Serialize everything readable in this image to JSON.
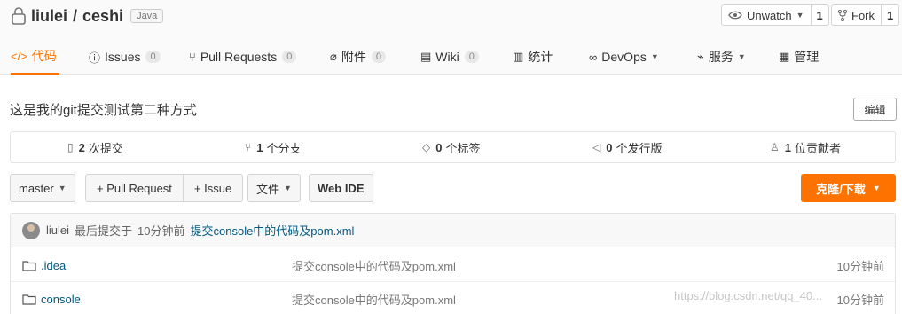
{
  "repo": {
    "owner": "liulei",
    "separator": "/",
    "name": "ceshi",
    "language": "Java"
  },
  "actions": {
    "watch_label": "Unwatch",
    "watch_count": "1",
    "fork_label": "Fork",
    "fork_count": "1"
  },
  "tabs": [
    {
      "label": "代码",
      "icon": "code-icon",
      "active": true
    },
    {
      "label": "Issues",
      "count": "0",
      "icon": "issue-icon"
    },
    {
      "label": "Pull Requests",
      "count": "0",
      "icon": "pull-request-icon"
    },
    {
      "label": "附件",
      "count": "0",
      "icon": "attachment-icon"
    },
    {
      "label": "Wiki",
      "count": "0",
      "icon": "wiki-icon"
    },
    {
      "label": "统计",
      "icon": "stats-icon"
    },
    {
      "label": "DevOps",
      "icon": "devops-icon"
    },
    {
      "label": "服务",
      "icon": "service-icon"
    },
    {
      "label": "管理",
      "icon": "manage-icon"
    }
  ],
  "description": "这是我的git提交测试第二种方式",
  "edit_label": "编辑",
  "stats": {
    "commits": {
      "count": "2",
      "label": "次提交"
    },
    "branches": {
      "count": "1",
      "label": "个分支"
    },
    "tags": {
      "count": "0",
      "label": "个标签"
    },
    "releases": {
      "count": "0",
      "label": "个发行版"
    },
    "contributors": {
      "count": "1",
      "label": "位贡献者"
    }
  },
  "toolbar": {
    "branch": "master",
    "pull_request": "+ Pull Request",
    "issue": "+ Issue",
    "file": "文件",
    "web_ide": "Web IDE",
    "clone": "克隆/下载"
  },
  "last_commit": {
    "author": "liulei",
    "prefix": "最后提交于",
    "time": "10分钟前",
    "message": "提交console中的代码及pom.xml"
  },
  "files": [
    {
      "name": ".idea",
      "message": "提交console中的代码及pom.xml",
      "time": "10分钟前"
    },
    {
      "name": "console",
      "message": "提交console中的代码及pom.xml",
      "time": "10分钟前"
    }
  ],
  "watermark": "https://blog.csdn.net/qq_40..."
}
